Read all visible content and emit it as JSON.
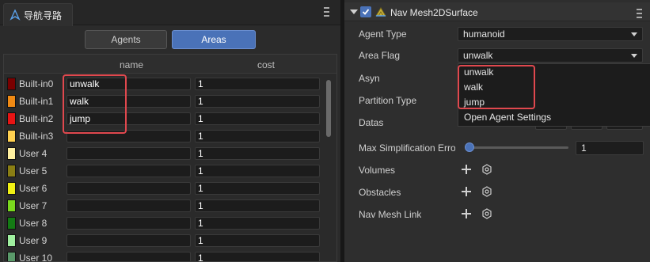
{
  "nav_panel": {
    "tab_title": "导航寻路",
    "segments": {
      "agents": "Agents",
      "areas": "Areas"
    },
    "columns": {
      "name": "name",
      "cost": "cost"
    },
    "rows": [
      {
        "label": "Built-in0",
        "color": "#7a0000",
        "name": "unwalk",
        "cost": "1"
      },
      {
        "label": "Built-in1",
        "color": "#f08a14",
        "name": "walk",
        "cost": "1"
      },
      {
        "label": "Built-in2",
        "color": "#e81414",
        "name": "jump",
        "cost": "1"
      },
      {
        "label": "Built-in3",
        "color": "#ffd050",
        "name": "",
        "cost": "1"
      },
      {
        "label": "User 4",
        "color": "#fff0a0",
        "name": "",
        "cost": "1"
      },
      {
        "label": "User 5",
        "color": "#8a7e14",
        "name": "",
        "cost": "1"
      },
      {
        "label": "User 6",
        "color": "#f0f014",
        "name": "",
        "cost": "1"
      },
      {
        "label": "User 7",
        "color": "#7ad81e",
        "name": "",
        "cost": "1"
      },
      {
        "label": "User 8",
        "color": "#147a14",
        "name": "",
        "cost": "1"
      },
      {
        "label": "User 9",
        "color": "#a0f0a0",
        "name": "",
        "cost": "1"
      },
      {
        "label": "User 10",
        "color": "#5a9a6a",
        "name": "",
        "cost": "1"
      }
    ]
  },
  "inspector": {
    "component_title": "Nav Mesh2DSurface",
    "enabled": true,
    "properties": {
      "agent_type": {
        "label": "Agent Type",
        "value": "humanoid"
      },
      "area_flag": {
        "label": "Area Flag",
        "value": "unwalk"
      },
      "asyn": {
        "label": "Asyn"
      },
      "partition_type": {
        "label": "Partition Type"
      },
      "datas": {
        "label": "Datas"
      },
      "max_simplification": {
        "label": "Max Simplification Erro",
        "value": "1"
      },
      "volumes": {
        "label": "Volumes"
      },
      "obstacles": {
        "label": "Obstacles"
      },
      "nav_mesh_link": {
        "label": "Nav Mesh Link"
      }
    },
    "area_flag_dropdown": {
      "options": [
        "unwalk",
        "walk",
        "jump"
      ],
      "settings_link": "Open Agent Settings"
    }
  },
  "colors": {
    "accent": "#4a72b8",
    "highlight": "#e0484e"
  }
}
